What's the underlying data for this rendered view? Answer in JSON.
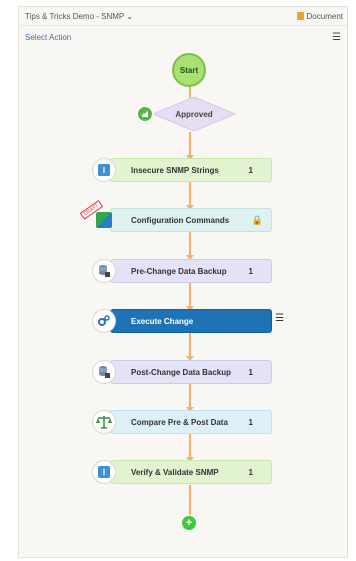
{
  "header": {
    "title": "Tips & Tricks Demo - SNMP",
    "document_label": "Document"
  },
  "actionbar": {
    "select_action": "Select Action",
    "menu_icon": "hamburger-menu-icon"
  },
  "flow": {
    "start_label": "Start",
    "decision_label": "Approved",
    "steps": [
      {
        "label": "Insecure SNMP Strings",
        "count": "1",
        "icon": "info-icon",
        "color": "#e2f4cf"
      },
      {
        "label": "Configuration Commands",
        "count": "",
        "icon": "config-icon",
        "lock": "lock-icon",
        "color": "#dff1f1"
      },
      {
        "label": "Pre-Change Data Backup",
        "count": "1",
        "icon": "database-icon",
        "color": "#e3e2f6"
      },
      {
        "label": "Execute Change",
        "count": "",
        "icon": "gears-icon",
        "color": "#1d73b5"
      },
      {
        "label": "Post-Change Data Backup",
        "count": "1",
        "icon": "database-icon",
        "color": "#e3e2f6"
      },
      {
        "label": "Compare Pre & Post Data",
        "count": "1",
        "icon": "scale-icon",
        "color": "#def0f7"
      },
      {
        "label": "Verify & Validate SNMP",
        "count": "1",
        "icon": "info-icon",
        "color": "#e2f4cf"
      }
    ],
    "add_icon": "add-step-icon"
  }
}
